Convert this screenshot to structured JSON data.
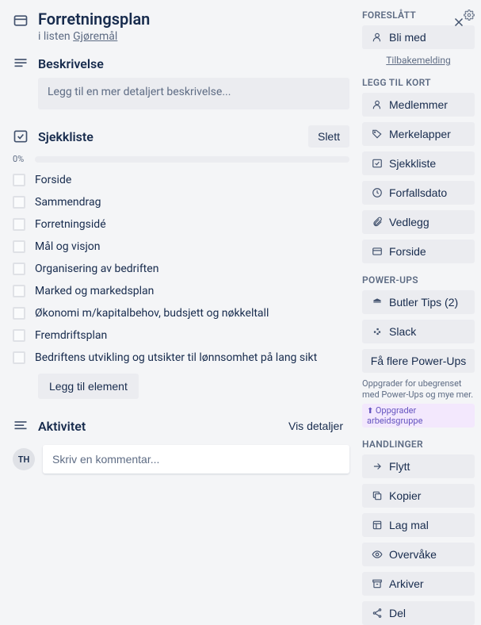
{
  "header": {
    "title": "Forretningsplan",
    "in_list_prefix": "i listen",
    "list_name": "Gjøremål"
  },
  "description": {
    "heading": "Beskrivelse",
    "placeholder": "Legg til en mer detaljert beskrivelse..."
  },
  "checklist": {
    "heading": "Sjekkliste",
    "delete_label": "Slett",
    "progress": "0%",
    "items": [
      {
        "label": "Forside"
      },
      {
        "label": "Sammendrag"
      },
      {
        "label": "Forretningsidé"
      },
      {
        "label": "Mål og visjon"
      },
      {
        "label": "Organisering av bedriften"
      },
      {
        "label": "Marked og markedsplan"
      },
      {
        "label": "Økonomi m/kapitalbehov, budsjett og nøkkeltall"
      },
      {
        "label": "Fremdriftsplan"
      },
      {
        "label": "Bedriftens utvikling og utsikter til lønnsomhet på lang sikt"
      }
    ],
    "add_label": "Legg til element"
  },
  "activity": {
    "heading": "Aktivitet",
    "toggle_label": "Vis detaljer",
    "avatar_initials": "TH",
    "comment_placeholder": "Skriv en kommentar..."
  },
  "sidebar": {
    "suggested": {
      "heading": "Foreslått",
      "join_label": "Bli med",
      "feedback_label": "Tilbakemelding"
    },
    "add_to_card": {
      "heading": "Legg til kort",
      "items": [
        {
          "icon": "members",
          "label": "Medlemmer"
        },
        {
          "icon": "labels",
          "label": "Merkelapper"
        },
        {
          "icon": "checklist",
          "label": "Sjekkliste"
        },
        {
          "icon": "due",
          "label": "Forfallsdato"
        },
        {
          "icon": "attachment",
          "label": "Vedlegg"
        },
        {
          "icon": "cover",
          "label": "Forside"
        }
      ]
    },
    "powerups": {
      "heading": "Power-Ups",
      "items": [
        {
          "icon": "butler",
          "label": "Butler Tips (2)"
        },
        {
          "icon": "slack",
          "label": "Slack"
        }
      ],
      "more_label": "Få flere Power-Ups",
      "upgrade_note": "Oppgrader for ubegrenset med Power-Ups og mye mer.",
      "upgrade_badge": "Oppgrader arbeidsgruppe"
    },
    "actions": {
      "heading": "Handlinger",
      "items": [
        {
          "icon": "move",
          "label": "Flytt"
        },
        {
          "icon": "copy",
          "label": "Kopier"
        },
        {
          "icon": "template",
          "label": "Lag mal"
        },
        {
          "icon": "watch",
          "label": "Overvåke"
        },
        {
          "icon": "archive",
          "label": "Arkiver"
        },
        {
          "icon": "share",
          "label": "Del"
        }
      ]
    }
  }
}
